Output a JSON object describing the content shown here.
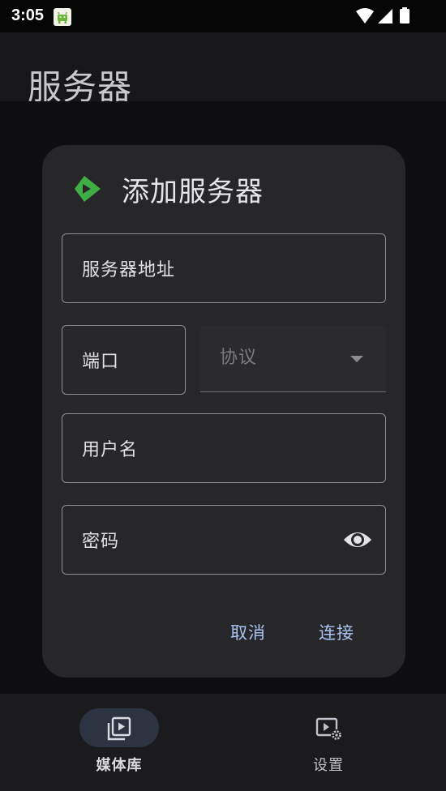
{
  "status_bar": {
    "time": "3:05",
    "icons": [
      "android-notification-icon",
      "wifi-icon",
      "cellular-signal-icon",
      "battery-icon"
    ]
  },
  "app_bar": {
    "title": "服务器"
  },
  "dialog": {
    "title": "添加服务器",
    "logo_icon": "play-logo-icon",
    "fields": {
      "server_address": {
        "label": "服务器地址",
        "value": ""
      },
      "port": {
        "label": "端口",
        "value": ""
      },
      "protocol": {
        "label": "协议",
        "value": ""
      },
      "username": {
        "label": "用户名",
        "value": ""
      },
      "password": {
        "label": "密码",
        "value": ""
      }
    },
    "actions": {
      "cancel": "取消",
      "connect": "连接"
    }
  },
  "bottom_nav": {
    "items": [
      {
        "label": "媒体库",
        "icon": "media-library-icon",
        "selected": true
      },
      {
        "label": "设置",
        "icon": "settings-icon",
        "selected": false
      }
    ]
  },
  "colors": {
    "accent_text": "#a9c4f5",
    "logo_green": "#3fae45",
    "dialog_surface": "#272729",
    "nav_pill": "#2c3441"
  }
}
